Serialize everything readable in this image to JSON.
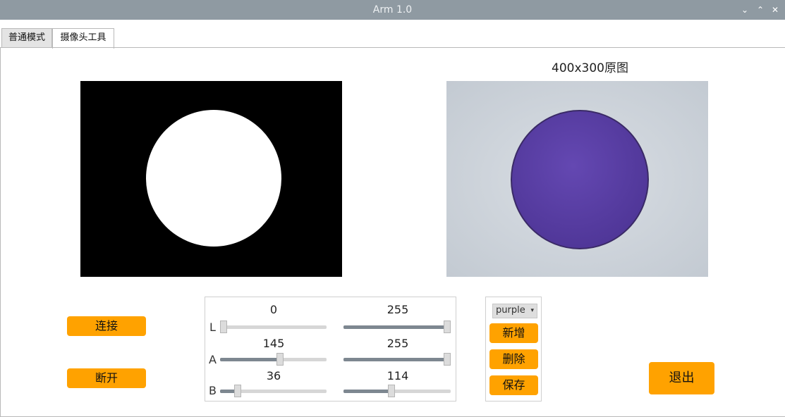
{
  "window": {
    "title": "Arm 1.0"
  },
  "tabs": [
    {
      "label": "普通模式"
    },
    {
      "label": "摄像头工具"
    }
  ],
  "camera": {
    "original_caption": "400x300原图"
  },
  "buttons": {
    "connect": "连接",
    "disconnect": "断开",
    "add": "新增",
    "delete": "删除",
    "save": "保存",
    "exit": "退出"
  },
  "color_select": {
    "value": "purple"
  },
  "sliders": {
    "L": {
      "label": "L",
      "min": 0,
      "max": 255
    },
    "A": {
      "label": "A",
      "min": 145,
      "max": 255
    },
    "B": {
      "label": "B",
      "min": 36,
      "max": 114
    }
  },
  "colors": {
    "accent": "#ffa200",
    "titlebar": "#8f9aa2",
    "purple_disk": "#5b3fa4"
  }
}
